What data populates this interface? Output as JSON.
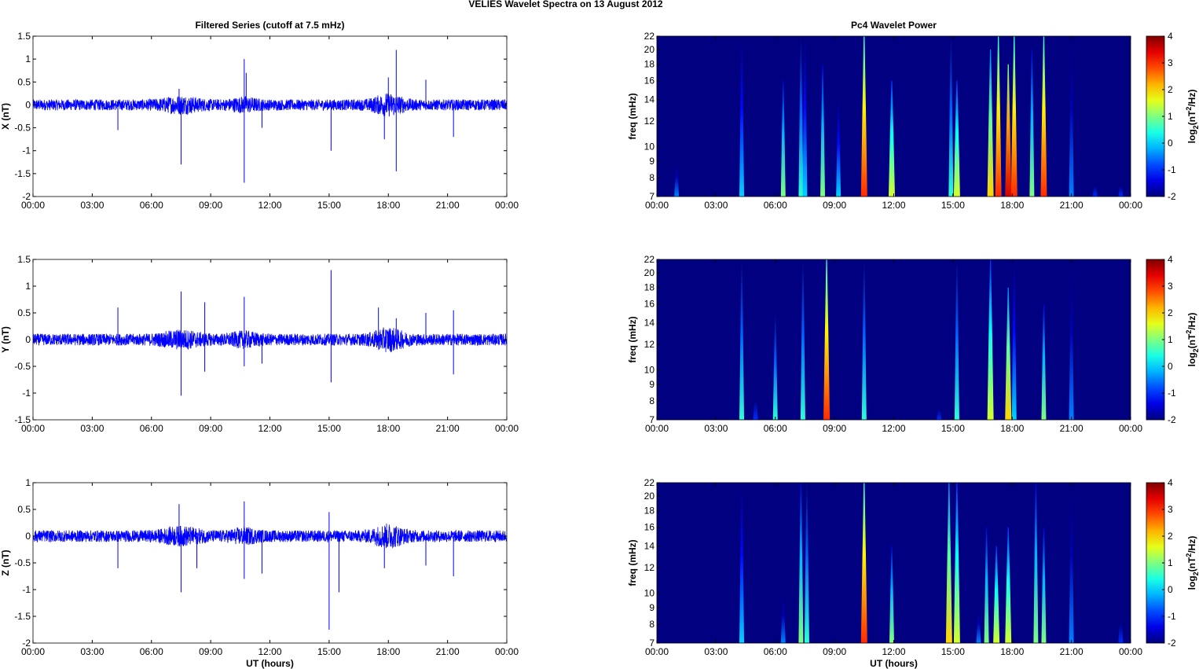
{
  "title": "VELIES Wavelet Spectra on 13 August    2012",
  "chart_data": [
    {
      "type": "line",
      "title": "Filtered Series (cutoff at 7.5 mHz)",
      "ylabel": "X (nT)",
      "xlabel": "",
      "ylim": [
        -2,
        1.5
      ],
      "yticks": [
        "-2",
        "-1.5",
        "-1",
        "-0.5",
        "0",
        "0.5",
        "1",
        "1.5"
      ],
      "xticks": [
        "00:00",
        "03:00",
        "06:00",
        "09:00",
        "12:00",
        "15:00",
        "18:00",
        "21:00",
        "00:00"
      ],
      "xlim_hours": [
        0,
        24
      ],
      "noise_amplitude": 0.12,
      "spikes": [
        [
          4.3,
          -0.55
        ],
        [
          7.4,
          0.35
        ],
        [
          7.5,
          -1.3
        ],
        [
          10.7,
          1.0
        ],
        [
          10.7,
          -1.7
        ],
        [
          10.8,
          0.7
        ],
        [
          11.6,
          -0.5
        ],
        [
          15.1,
          -1.0
        ],
        [
          17.8,
          -0.75
        ],
        [
          18.0,
          0.6
        ],
        [
          18.4,
          1.2
        ],
        [
          18.4,
          -1.45
        ],
        [
          19.9,
          0.55
        ],
        [
          21.3,
          -0.7
        ]
      ]
    },
    {
      "type": "line",
      "title": "",
      "ylabel": "Y (nT)",
      "xlabel": "",
      "ylim": [
        -1.5,
        1.5
      ],
      "yticks": [
        "-1.5",
        "-1",
        "-0.5",
        "0",
        "0.5",
        "1",
        "1.5"
      ],
      "xticks": [
        "00:00",
        "03:00",
        "06:00",
        "09:00",
        "12:00",
        "15:00",
        "18:00",
        "21:00",
        "00:00"
      ],
      "xlim_hours": [
        0,
        24
      ],
      "noise_amplitude": 0.11,
      "spikes": [
        [
          4.3,
          0.6
        ],
        [
          7.5,
          0.9
        ],
        [
          7.5,
          -1.05
        ],
        [
          8.7,
          0.7
        ],
        [
          8.7,
          -0.6
        ],
        [
          10.7,
          0.8
        ],
        [
          10.7,
          -0.5
        ],
        [
          11.6,
          -0.45
        ],
        [
          15.1,
          1.3
        ],
        [
          15.1,
          -0.8
        ],
        [
          17.5,
          0.6
        ],
        [
          18.4,
          0.4
        ],
        [
          19.9,
          0.5
        ],
        [
          21.3,
          0.55
        ],
        [
          21.3,
          -0.65
        ]
      ]
    },
    {
      "type": "line",
      "title": "",
      "ylabel": "Z (nT)",
      "xlabel": "UT (hours)",
      "ylim": [
        -2,
        1
      ],
      "yticks": [
        "-2",
        "-1.5",
        "-1",
        "-0.5",
        "0",
        "0.5",
        "1"
      ],
      "xticks": [
        "00:00",
        "03:00",
        "06:00",
        "09:00",
        "12:00",
        "15:00",
        "18:00",
        "21:00",
        "00:00"
      ],
      "xlim_hours": [
        0,
        24
      ],
      "noise_amplitude": 0.11,
      "spikes": [
        [
          4.3,
          -0.6
        ],
        [
          7.4,
          0.6
        ],
        [
          7.5,
          -1.05
        ],
        [
          8.3,
          -0.6
        ],
        [
          10.7,
          0.65
        ],
        [
          10.7,
          -0.8
        ],
        [
          11.6,
          -0.7
        ],
        [
          15.0,
          0.45
        ],
        [
          15.0,
          -1.75
        ],
        [
          15.5,
          -1.05
        ],
        [
          17.8,
          -0.6
        ],
        [
          19.9,
          -0.55
        ],
        [
          21.3,
          -0.75
        ]
      ]
    },
    {
      "type": "heatmap",
      "title": "Pc4 Wavelet Power",
      "ylabel": "freq (mHz)",
      "xlabel": "",
      "ylim": [
        7,
        22
      ],
      "yscale": "log",
      "yticks": [
        "7",
        "8",
        "9",
        "10",
        "12",
        "14",
        "16",
        "18",
        "20",
        "22"
      ],
      "xticks": [
        "00:00",
        "03:00",
        "06:00",
        "09:00",
        "12:00",
        "15:00",
        "18:00",
        "21:00",
        "00:00"
      ],
      "clim": [
        -2,
        4
      ],
      "cticks": [
        "-2",
        "-1",
        "0",
        "1",
        "2",
        "3",
        "4"
      ],
      "clabel": "log2(nT^2/Hz)",
      "events": [
        [
          1.0,
          -0.5,
          9
        ],
        [
          4.3,
          0,
          22
        ],
        [
          6.4,
          1,
          16
        ],
        [
          7.3,
          0.5,
          22
        ],
        [
          7.5,
          0,
          22
        ],
        [
          8.4,
          1,
          18
        ],
        [
          9.2,
          0,
          14
        ],
        [
          10.5,
          3,
          22
        ],
        [
          11.9,
          1.5,
          16
        ],
        [
          14.9,
          0.5,
          22
        ],
        [
          15.2,
          1.5,
          16
        ],
        [
          16.9,
          2,
          20
        ],
        [
          17.3,
          3,
          22
        ],
        [
          17.8,
          3.5,
          18
        ],
        [
          18.1,
          3,
          22
        ],
        [
          19.0,
          1,
          20
        ],
        [
          19.6,
          3,
          22
        ],
        [
          21.0,
          -0.5,
          22
        ],
        [
          22.2,
          -1,
          8
        ],
        [
          23.5,
          -1,
          8
        ]
      ]
    },
    {
      "type": "heatmap",
      "title": "",
      "ylabel": "freq (mHz)",
      "xlabel": "",
      "ylim": [
        7,
        22
      ],
      "yscale": "log",
      "yticks": [
        "7",
        "8",
        "9",
        "10",
        "12",
        "14",
        "16",
        "18",
        "20",
        "22"
      ],
      "xticks": [
        "00:00",
        "03:00",
        "06:00",
        "09:00",
        "12:00",
        "15:00",
        "18:00",
        "21:00",
        "00:00"
      ],
      "clim": [
        -2,
        4
      ],
      "cticks": [
        "-2",
        "-1",
        "0",
        "1",
        "2",
        "3",
        "4"
      ],
      "clabel": "log2(nT^2/Hz)",
      "events": [
        [
          4.3,
          0.5,
          22
        ],
        [
          5.0,
          -1,
          9
        ],
        [
          6.0,
          0.5,
          15
        ],
        [
          7.4,
          0.5,
          22
        ],
        [
          8.6,
          3,
          22
        ],
        [
          10.5,
          0.5,
          22
        ],
        [
          14.3,
          -1,
          8
        ],
        [
          15.2,
          0.5,
          22
        ],
        [
          16.9,
          1.5,
          22
        ],
        [
          17.8,
          2,
          18
        ],
        [
          18.1,
          0,
          22
        ],
        [
          19.6,
          1,
          16
        ],
        [
          21.0,
          -0.5,
          22
        ]
      ]
    },
    {
      "type": "heatmap",
      "title": "",
      "ylabel": "freq (mHz)",
      "xlabel": "UT (hours)",
      "ylim": [
        7,
        22
      ],
      "yscale": "log",
      "yticks": [
        "7",
        "8",
        "9",
        "10",
        "12",
        "14",
        "16",
        "18",
        "20",
        "22"
      ],
      "xticks": [
        "00:00",
        "03:00",
        "06:00",
        "09:00",
        "12:00",
        "15:00",
        "18:00",
        "21:00",
        "00:00"
      ],
      "clim": [
        -2,
        4
      ],
      "cticks": [
        "-2",
        "-1",
        "0",
        "1",
        "2",
        "3",
        "4"
      ],
      "clabel": "log2(nT^2/Hz)",
      "events": [
        [
          4.3,
          0,
          22
        ],
        [
          6.4,
          -0.5,
          10
        ],
        [
          7.3,
          1,
          22
        ],
        [
          7.6,
          0.5,
          22
        ],
        [
          10.5,
          3,
          22
        ],
        [
          11.9,
          1,
          14
        ],
        [
          14.8,
          2,
          22
        ],
        [
          15.2,
          1.5,
          22
        ],
        [
          16.3,
          -0.5,
          9
        ],
        [
          16.7,
          1,
          16
        ],
        [
          17.2,
          1.5,
          14
        ],
        [
          17.8,
          1.5,
          16
        ],
        [
          19.2,
          1,
          22
        ],
        [
          19.6,
          1,
          16
        ],
        [
          21.0,
          -0.5,
          22
        ],
        [
          23.5,
          -1,
          9
        ]
      ]
    }
  ]
}
